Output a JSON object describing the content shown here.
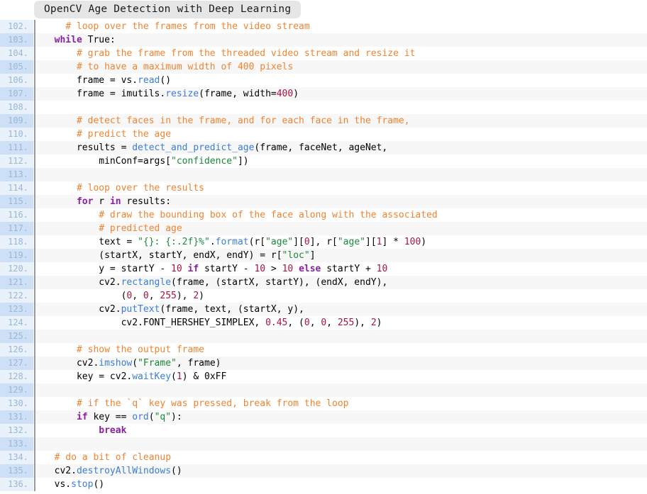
{
  "window": {
    "title": "OpenCV Age Detection with Deep Learning"
  },
  "colors": {
    "background": "#ffffff",
    "row_alt": "#f7f7f7",
    "gutter_odd": "#e9f1fb",
    "gutter_even": "#cde0f5",
    "gutter_text": "#9bb7d4",
    "rule": "#9a9a9a",
    "title_chip": "#e6e6e6",
    "comment": "#f08330",
    "keyword": "#8b20a0",
    "function": "#3b7dd8",
    "string": "#178a3a",
    "number": "#a8143c",
    "plain": "#000000"
  },
  "editor": {
    "first_line": 102,
    "last_line": 136,
    "language": "python",
    "lines": [
      {
        "n": "102.",
        "tokens": [
          {
            "t": "    ",
            "c": "plain"
          },
          {
            "t": "# loop over the frames from the video stream",
            "c": "comment"
          }
        ]
      },
      {
        "n": "103.",
        "tokens": [
          {
            "t": "  ",
            "c": "plain"
          },
          {
            "t": "while",
            "c": "keyword"
          },
          {
            "t": " True:",
            "c": "plain"
          }
        ]
      },
      {
        "n": "104.",
        "tokens": [
          {
            "t": "      ",
            "c": "plain"
          },
          {
            "t": "# grab the frame from the threaded video stream and resize it",
            "c": "comment"
          }
        ]
      },
      {
        "n": "105.",
        "tokens": [
          {
            "t": "      ",
            "c": "plain"
          },
          {
            "t": "# to have a maximum width of 400 pixels",
            "c": "comment"
          }
        ]
      },
      {
        "n": "106.",
        "tokens": [
          {
            "t": "      frame = vs.",
            "c": "plain"
          },
          {
            "t": "read",
            "c": "func"
          },
          {
            "t": "()",
            "c": "plain"
          }
        ]
      },
      {
        "n": "107.",
        "tokens": [
          {
            "t": "      frame = imutils.",
            "c": "plain"
          },
          {
            "t": "resize",
            "c": "func"
          },
          {
            "t": "(frame, width=",
            "c": "plain"
          },
          {
            "t": "400",
            "c": "number"
          },
          {
            "t": ")",
            "c": "plain"
          }
        ]
      },
      {
        "n": "108.",
        "tokens": []
      },
      {
        "n": "109.",
        "tokens": [
          {
            "t": "      ",
            "c": "plain"
          },
          {
            "t": "# detect faces in the frame, and for each face in the frame,",
            "c": "comment"
          }
        ]
      },
      {
        "n": "110.",
        "tokens": [
          {
            "t": "      ",
            "c": "plain"
          },
          {
            "t": "# predict the age",
            "c": "comment"
          }
        ]
      },
      {
        "n": "111.",
        "tokens": [
          {
            "t": "      results = ",
            "c": "plain"
          },
          {
            "t": "detect_and_predict_age",
            "c": "func"
          },
          {
            "t": "(frame, faceNet, ageNet,",
            "c": "plain"
          }
        ]
      },
      {
        "n": "112.",
        "tokens": [
          {
            "t": "          minConf=args[",
            "c": "plain"
          },
          {
            "t": "\"confidence\"",
            "c": "string"
          },
          {
            "t": "])",
            "c": "plain"
          }
        ]
      },
      {
        "n": "113.",
        "tokens": []
      },
      {
        "n": "114.",
        "tokens": [
          {
            "t": "      ",
            "c": "plain"
          },
          {
            "t": "# loop over the results",
            "c": "comment"
          }
        ]
      },
      {
        "n": "115.",
        "tokens": [
          {
            "t": "      ",
            "c": "plain"
          },
          {
            "t": "for",
            "c": "keyword"
          },
          {
            "t": " r ",
            "c": "plain"
          },
          {
            "t": "in",
            "c": "keyword"
          },
          {
            "t": " results:",
            "c": "plain"
          }
        ]
      },
      {
        "n": "116.",
        "tokens": [
          {
            "t": "          ",
            "c": "plain"
          },
          {
            "t": "# draw the bounding box of the face along with the associated",
            "c": "comment"
          }
        ]
      },
      {
        "n": "117.",
        "tokens": [
          {
            "t": "          ",
            "c": "plain"
          },
          {
            "t": "# predicted age",
            "c": "comment"
          }
        ]
      },
      {
        "n": "118.",
        "tokens": [
          {
            "t": "          text = ",
            "c": "plain"
          },
          {
            "t": "\"{}: {:.2f}%\"",
            "c": "string"
          },
          {
            "t": ".",
            "c": "plain"
          },
          {
            "t": "format",
            "c": "func"
          },
          {
            "t": "(r[",
            "c": "plain"
          },
          {
            "t": "\"age\"",
            "c": "string"
          },
          {
            "t": "][",
            "c": "plain"
          },
          {
            "t": "0",
            "c": "number"
          },
          {
            "t": "], r[",
            "c": "plain"
          },
          {
            "t": "\"age\"",
            "c": "string"
          },
          {
            "t": "][",
            "c": "plain"
          },
          {
            "t": "1",
            "c": "number"
          },
          {
            "t": "] * ",
            "c": "plain"
          },
          {
            "t": "100",
            "c": "number"
          },
          {
            "t": ")",
            "c": "plain"
          }
        ]
      },
      {
        "n": "119.",
        "tokens": [
          {
            "t": "          (startX, startY, endX, endY) = r[",
            "c": "plain"
          },
          {
            "t": "\"loc\"",
            "c": "string"
          },
          {
            "t": "]",
            "c": "plain"
          }
        ]
      },
      {
        "n": "120.",
        "tokens": [
          {
            "t": "          y = startY - ",
            "c": "plain"
          },
          {
            "t": "10",
            "c": "number"
          },
          {
            "t": " ",
            "c": "plain"
          },
          {
            "t": "if",
            "c": "keyword"
          },
          {
            "t": " startY - ",
            "c": "plain"
          },
          {
            "t": "10",
            "c": "number"
          },
          {
            "t": " > ",
            "c": "plain"
          },
          {
            "t": "10",
            "c": "number"
          },
          {
            "t": " ",
            "c": "plain"
          },
          {
            "t": "else",
            "c": "keyword"
          },
          {
            "t": " startY + ",
            "c": "plain"
          },
          {
            "t": "10",
            "c": "number"
          }
        ]
      },
      {
        "n": "121.",
        "tokens": [
          {
            "t": "          cv2.",
            "c": "plain"
          },
          {
            "t": "rectangle",
            "c": "func"
          },
          {
            "t": "(frame, (startX, startY), (endX, endY),",
            "c": "plain"
          }
        ]
      },
      {
        "n": "122.",
        "tokens": [
          {
            "t": "              (",
            "c": "plain"
          },
          {
            "t": "0",
            "c": "number"
          },
          {
            "t": ", ",
            "c": "plain"
          },
          {
            "t": "0",
            "c": "number"
          },
          {
            "t": ", ",
            "c": "plain"
          },
          {
            "t": "255",
            "c": "number"
          },
          {
            "t": "), ",
            "c": "plain"
          },
          {
            "t": "2",
            "c": "number"
          },
          {
            "t": ")",
            "c": "plain"
          }
        ]
      },
      {
        "n": "123.",
        "tokens": [
          {
            "t": "          cv2.",
            "c": "plain"
          },
          {
            "t": "putText",
            "c": "func"
          },
          {
            "t": "(frame, text, (startX, y),",
            "c": "plain"
          }
        ]
      },
      {
        "n": "124.",
        "tokens": [
          {
            "t": "              cv2.FONT_HERSHEY_SIMPLEX, ",
            "c": "plain"
          },
          {
            "t": "0.45",
            "c": "number"
          },
          {
            "t": ", (",
            "c": "plain"
          },
          {
            "t": "0",
            "c": "number"
          },
          {
            "t": ", ",
            "c": "plain"
          },
          {
            "t": "0",
            "c": "number"
          },
          {
            "t": ", ",
            "c": "plain"
          },
          {
            "t": "255",
            "c": "number"
          },
          {
            "t": "), ",
            "c": "plain"
          },
          {
            "t": "2",
            "c": "number"
          },
          {
            "t": ")",
            "c": "plain"
          }
        ]
      },
      {
        "n": "125.",
        "tokens": []
      },
      {
        "n": "126.",
        "tokens": [
          {
            "t": "      ",
            "c": "plain"
          },
          {
            "t": "# show the output frame",
            "c": "comment"
          }
        ]
      },
      {
        "n": "127.",
        "tokens": [
          {
            "t": "      cv2.",
            "c": "plain"
          },
          {
            "t": "imshow",
            "c": "func"
          },
          {
            "t": "(",
            "c": "plain"
          },
          {
            "t": "\"Frame\"",
            "c": "string"
          },
          {
            "t": ", frame)",
            "c": "plain"
          }
        ]
      },
      {
        "n": "128.",
        "tokens": [
          {
            "t": "      key = cv2.",
            "c": "plain"
          },
          {
            "t": "waitKey",
            "c": "func"
          },
          {
            "t": "(",
            "c": "plain"
          },
          {
            "t": "1",
            "c": "number"
          },
          {
            "t": ") & 0xFF",
            "c": "plain"
          }
        ]
      },
      {
        "n": "129.",
        "tokens": []
      },
      {
        "n": "130.",
        "tokens": [
          {
            "t": "      ",
            "c": "plain"
          },
          {
            "t": "# if the `q` key was pressed, break from the loop",
            "c": "comment"
          }
        ]
      },
      {
        "n": "131.",
        "tokens": [
          {
            "t": "      ",
            "c": "plain"
          },
          {
            "t": "if",
            "c": "keyword"
          },
          {
            "t": " key == ",
            "c": "plain"
          },
          {
            "t": "ord",
            "c": "func"
          },
          {
            "t": "(",
            "c": "plain"
          },
          {
            "t": "\"q\"",
            "c": "string"
          },
          {
            "t": "):",
            "c": "plain"
          }
        ]
      },
      {
        "n": "132.",
        "tokens": [
          {
            "t": "          ",
            "c": "plain"
          },
          {
            "t": "break",
            "c": "keyword"
          }
        ]
      },
      {
        "n": "133.",
        "tokens": []
      },
      {
        "n": "134.",
        "tokens": [
          {
            "t": "  ",
            "c": "plain"
          },
          {
            "t": "# do a bit of cleanup",
            "c": "comment"
          }
        ]
      },
      {
        "n": "135.",
        "tokens": [
          {
            "t": "  cv2.",
            "c": "plain"
          },
          {
            "t": "destroyAllWindows",
            "c": "func"
          },
          {
            "t": "()",
            "c": "plain"
          }
        ]
      },
      {
        "n": "136.",
        "tokens": [
          {
            "t": "  vs.",
            "c": "plain"
          },
          {
            "t": "stop",
            "c": "func"
          },
          {
            "t": "()",
            "c": "plain"
          }
        ]
      }
    ]
  }
}
